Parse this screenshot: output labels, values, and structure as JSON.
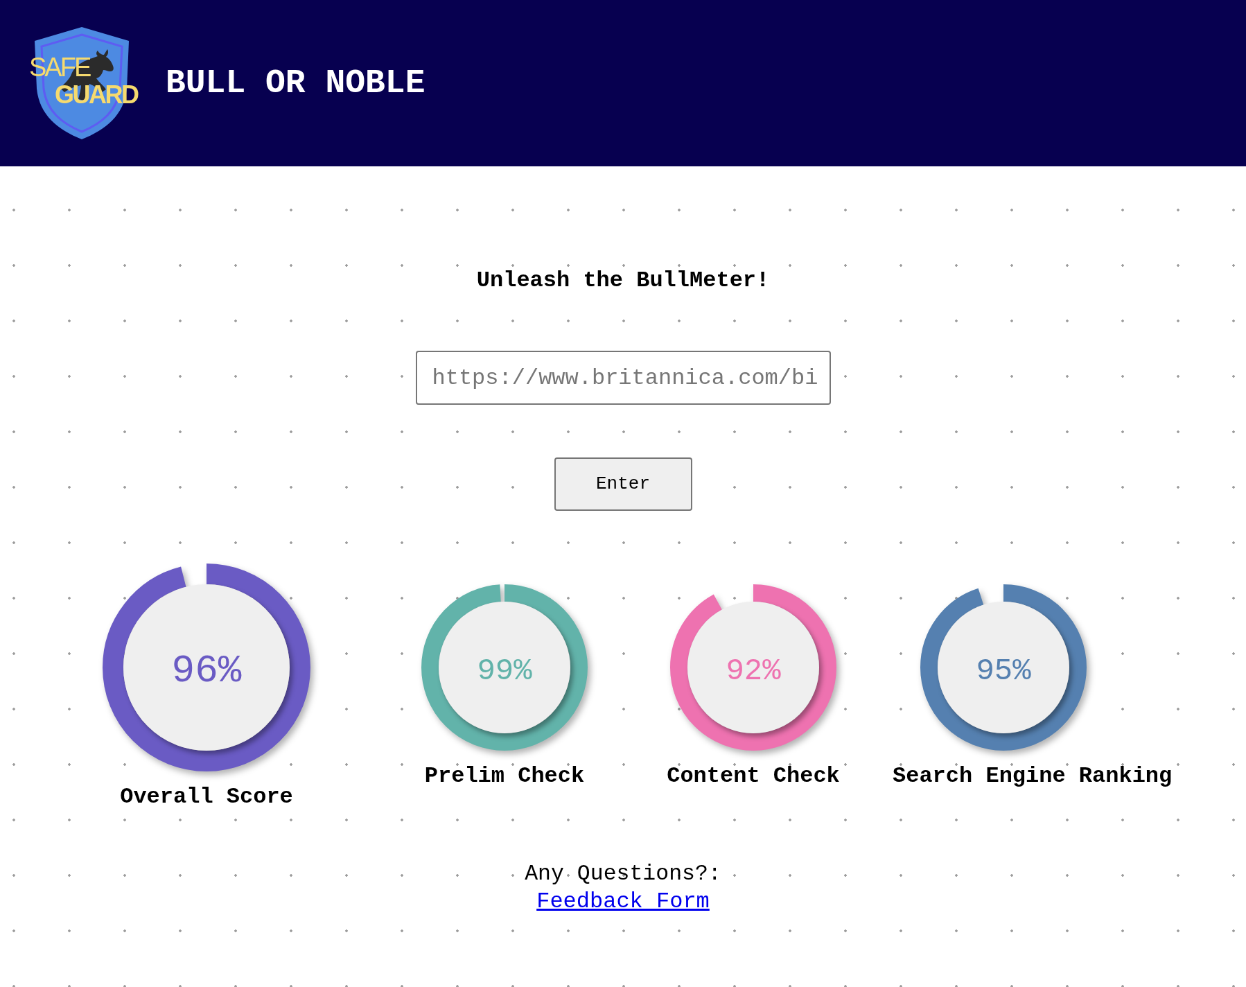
{
  "header": {
    "logo": {
      "line_1": "SAFE",
      "line_2": "GUARD"
    },
    "title": "BULL OR NOBLE"
  },
  "heading": "Unleash the BullMeter!",
  "url_field": {
    "placeholder": "https://www.britannica.com/bi"
  },
  "enter_button": "Enter",
  "scores": [
    {
      "kind": "overall",
      "reading": "96%",
      "level": 0.96,
      "color": "#6a5bc4",
      "label": "Overall Score"
    },
    {
      "kind": "check",
      "reading": "99%",
      "level": 0.99,
      "color": "#62b3aa",
      "label": "Prelim Check"
    },
    {
      "kind": "check",
      "reading": "92%",
      "level": 0.92,
      "color": "#ee72b0",
      "label": "Content Check"
    },
    {
      "kind": "check",
      "reading": "95%",
      "level": 0.95,
      "color": "#5580b0",
      "label": "Search Engine Ranking"
    }
  ],
  "footer": {
    "question": "Any Questions?:",
    "link": "Feedback Form"
  }
}
